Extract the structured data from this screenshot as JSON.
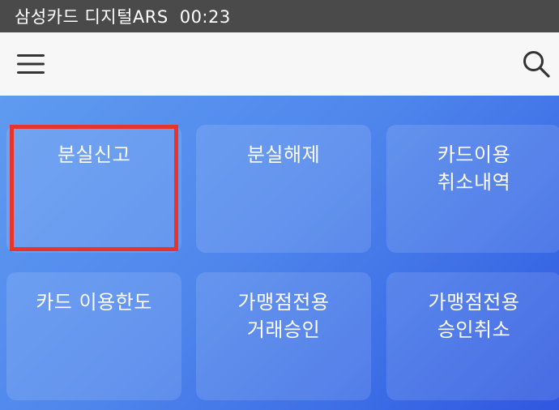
{
  "status_bar": {
    "title": "삼성카드 디지털ARS",
    "time": "00:23"
  },
  "app_bar": {
    "menu_icon": "hamburger-menu-icon",
    "search_icon": "search-icon"
  },
  "tiles": [
    {
      "label": "분실신고"
    },
    {
      "label": "분실해제"
    },
    {
      "label": "카드이용\n취소내역"
    },
    {
      "label": "카드 이용한도"
    },
    {
      "label": "가맹점전용\n거래승인"
    },
    {
      "label": "가맹점전용\n승인취소"
    }
  ],
  "colors": {
    "status_bar_bg": "#4a4a4a",
    "app_bar_bg": "#f7f7f8",
    "main_gradient_start": "#5f9bf0",
    "main_gradient_end": "#2f57e0",
    "highlight_border": "#e8352c"
  }
}
